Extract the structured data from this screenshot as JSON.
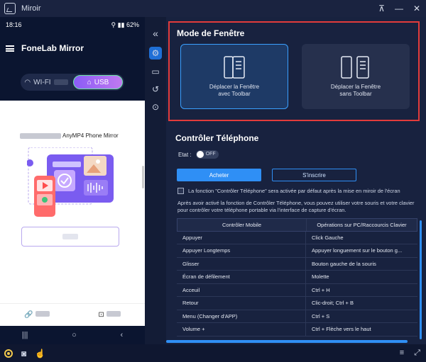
{
  "window": {
    "title": "Miroir",
    "pin_icon": "pin-icon",
    "minimize_icon": "minimize-icon",
    "close_icon": "close-icon"
  },
  "phone": {
    "status_time": "18:16",
    "status_battery": "62%",
    "app_title": "FoneLab Mirror",
    "wifi_label": "WI-FI",
    "usb_label": "USB",
    "card_title": "AnyMP4 Phone Mirror",
    "nav": {
      "back": "‹",
      "home": "○",
      "recent": "|||"
    }
  },
  "sidebar": {
    "collapse_label": "«"
  },
  "mode": {
    "title": "Mode de Fenêtre",
    "option1_line1": "Déplacer la Fenêtre",
    "option1_line2": "avec Toolbar",
    "option2_line1": "Déplacer la Fenêtre",
    "option2_line2": "sans Toolbar"
  },
  "control": {
    "title": "Contrôler Téléphone",
    "etat_label": "Etat :",
    "toggle_label": "OFF",
    "buy_label": "Acheter",
    "register_label": "S'inscrire",
    "checkbox_label": "La fonction \"Contrôler Téléphone\" sera activée par défaut après la mise en miroir de l'écran",
    "description": "Après avoir activé la fonction de Contrôler Téléphone, vous pouvez utiliser votre souris et votre clavier pour contrôler votre téléphone portable via l'interface de capture d'écran."
  },
  "table": {
    "headers": [
      "Contrôler Mobile",
      "Opérations sur PC/Raccourcis Clavier"
    ],
    "rows": [
      [
        "Appuyer",
        "Click Gauche"
      ],
      [
        "Appuyer Longtemps",
        "Appuyer longuement sur le bouton g..."
      ],
      [
        "Glisser",
        "Bouton gauche de la souris"
      ],
      [
        "Écran de défilement",
        "Molette"
      ],
      [
        "Acceuil",
        "Ctrl + H"
      ],
      [
        "Retour",
        "Clic-droit; Ctrl + B"
      ],
      [
        "Menu (Changer d'APP)",
        "Ctrl + S"
      ],
      [
        "Volume +",
        "Ctrl + Flèche vers le haut"
      ]
    ]
  },
  "colors": {
    "accent": "#2f8ff5",
    "highlight_border": "#e23b3b",
    "usb_gradient_start": "#8a5cf6"
  }
}
